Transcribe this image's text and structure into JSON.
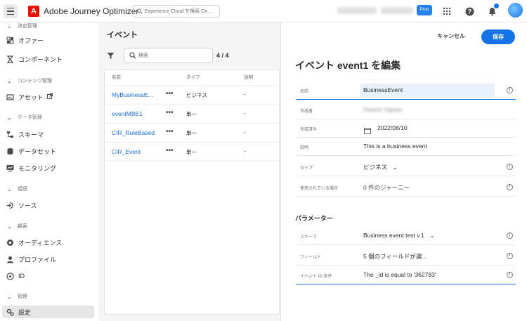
{
  "topbar": {
    "app_title": "Adobe Journey Optimizer",
    "search_placeholder": "Experience Cloud を検索 Ctr...",
    "prod_chip": "Prod"
  },
  "sidebar": {
    "sections": [
      {
        "label": "決定管理"
      },
      {
        "label": "コンテンツ管理"
      },
      {
        "label": "データ管理"
      },
      {
        "label": "接続"
      },
      {
        "label": "顧客"
      },
      {
        "label": "管理"
      }
    ],
    "items": [
      {
        "label": "オファー",
        "icon": "offer-icon"
      },
      {
        "label": "コンポーネント",
        "icon": "component-icon"
      },
      {
        "label": "アセット",
        "icon": "asset-icon"
      },
      {
        "label": "スキーマ",
        "icon": "schema-icon"
      },
      {
        "label": "データセット",
        "icon": "dataset-icon"
      },
      {
        "label": "モニタリング",
        "icon": "monitoring-icon"
      },
      {
        "label": "ソース",
        "icon": "source-icon"
      },
      {
        "label": "オーディエンス",
        "icon": "audience-icon"
      },
      {
        "label": "プロファイル",
        "icon": "profile-icon"
      },
      {
        "label": "ID",
        "icon": "identity-icon"
      },
      {
        "label": "設定",
        "icon": "settings-icon"
      }
    ]
  },
  "events_panel": {
    "title": "イベント",
    "search_placeholder": "検索",
    "count": "4 / 4",
    "columns": [
      "名前",
      "タイプ",
      "説明"
    ],
    "rows": [
      {
        "name": "MyBusinessE...",
        "type": "ビジネス",
        "desc": "-"
      },
      {
        "name": "eventMBE1",
        "type": "単一",
        "desc": "-"
      },
      {
        "name": "CIR_RuleBased",
        "type": "単一",
        "desc": "-"
      },
      {
        "name": "CIR_Event",
        "type": "単一",
        "desc": "-"
      }
    ]
  },
  "edit_panel": {
    "cancel": "キャンセル",
    "save": "保存",
    "title": "イベント event1 を編集",
    "fields": [
      {
        "label": "名前",
        "value": "BusinessEvent"
      },
      {
        "label": "作成者",
        "value": "Florent Vignes"
      },
      {
        "label": "作成済み",
        "value": "2022/08/10"
      },
      {
        "label": "説明",
        "value": "This is a business event"
      },
      {
        "label": "タイプ",
        "value": "ビジネス"
      },
      {
        "label": "使用されている場所",
        "value": "0 件のジャーニー"
      }
    ],
    "params_title": "パラメーター",
    "params": [
      {
        "label": "スキーマ",
        "value": "Business event test v.1"
      },
      {
        "label": "フィールド",
        "value": "5 個のフィールドが選…"
      },
      {
        "label": "イベント ID 条件",
        "value": "The _id is equal to '362783'"
      }
    ]
  },
  "colors": {
    "accent": "#1473e6",
    "brand": "#eb1000"
  }
}
